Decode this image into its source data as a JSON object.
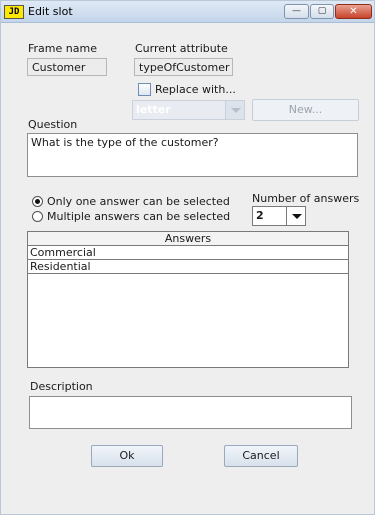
{
  "window": {
    "app_icon": "JD",
    "title": "Edit slot",
    "minimize_icon": "—",
    "maximize_icon": "▢",
    "close_icon": "✕"
  },
  "frame_name": {
    "label": "Frame name",
    "value": "Customer"
  },
  "current_attribute": {
    "label": "Current attribute",
    "value": "typeOfCustomer"
  },
  "replace": {
    "label": "Replace with...",
    "checked": false,
    "combo_value": "letter",
    "new_button": "New..."
  },
  "question": {
    "label": "Question",
    "text": "What is the type of the customer?"
  },
  "answer_mode": {
    "options": [
      {
        "label": "Only one answer can be selected",
        "selected": true
      },
      {
        "label": "Multiple answers can be selected",
        "selected": false
      }
    ]
  },
  "number_of_answers": {
    "label": "Number of answers",
    "value": "2"
  },
  "answers": {
    "header": "Answers",
    "rows": [
      "Commercial",
      "Residential"
    ]
  },
  "description": {
    "label": "Description",
    "text": ""
  },
  "buttons": {
    "ok": "Ok",
    "cancel": "Cancel"
  }
}
